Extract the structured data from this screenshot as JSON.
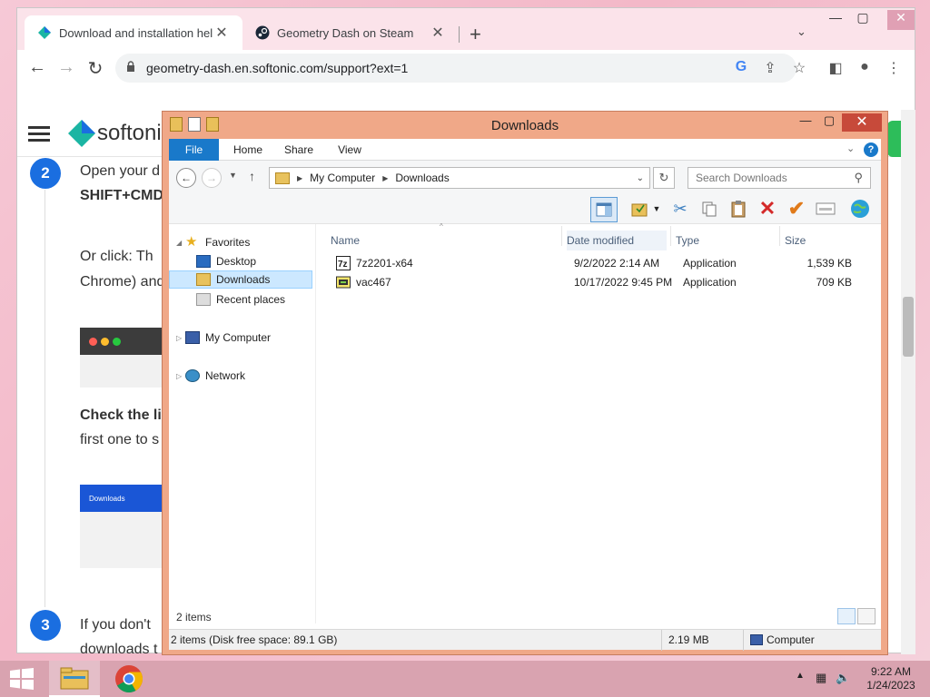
{
  "browser": {
    "tabs": [
      {
        "label": "Download and installation help",
        "close": "✕"
      },
      {
        "label": "Geometry Dash on Steam",
        "close": "✕"
      }
    ],
    "new_tab": "+",
    "tab_menu": "⌄",
    "url": "geometry-dash.en.softonic.com/support?ext=1",
    "window_controls": {
      "minimize": "—",
      "maximize": "▢",
      "close": "✕"
    }
  },
  "page": {
    "logo_text": "softonic",
    "steps": [
      {
        "num": "2"
      },
      {
        "num": "3"
      }
    ],
    "lines": [
      "Open your d",
      "SHIFT+CMD",
      "Or click:  Th",
      "Chrome) and",
      "Check the li",
      "first one to s",
      "If you don't",
      "downloads t"
    ],
    "shot_label": "Downloads"
  },
  "explorer": {
    "title": "Downloads",
    "window_controls": {
      "minimize": "—",
      "maximize": "▢",
      "close": "✕"
    },
    "ribbon_tabs": [
      "File",
      "Home",
      "Share",
      "View"
    ],
    "breadcrumb": [
      "My Computer",
      "Downloads"
    ],
    "search_placeholder": "Search Downloads",
    "nav": {
      "favorites": "Favorites",
      "desktop": "Desktop",
      "downloads": "Downloads",
      "recent": "Recent places",
      "computer": "My Computer",
      "network": "Network"
    },
    "columns": {
      "name": "Name",
      "date": "Date modified",
      "type": "Type",
      "size": "Size"
    },
    "files": [
      {
        "name": "7z2201-x64",
        "date": "9/2/2022 2:14 AM",
        "type": "Application",
        "size": "1,539 KB"
      },
      {
        "name": "vac467",
        "date": "10/17/2022 9:45 PM",
        "type": "Application",
        "size": "709 KB"
      }
    ],
    "item_count": "2 items",
    "status": {
      "left": "2 items (Disk free space: 89.1 GB)",
      "size": "2.19 MB",
      "location": "Computer"
    }
  },
  "taskbar": {
    "clock_time": "9:22 AM",
    "clock_date": "1/24/2023"
  }
}
